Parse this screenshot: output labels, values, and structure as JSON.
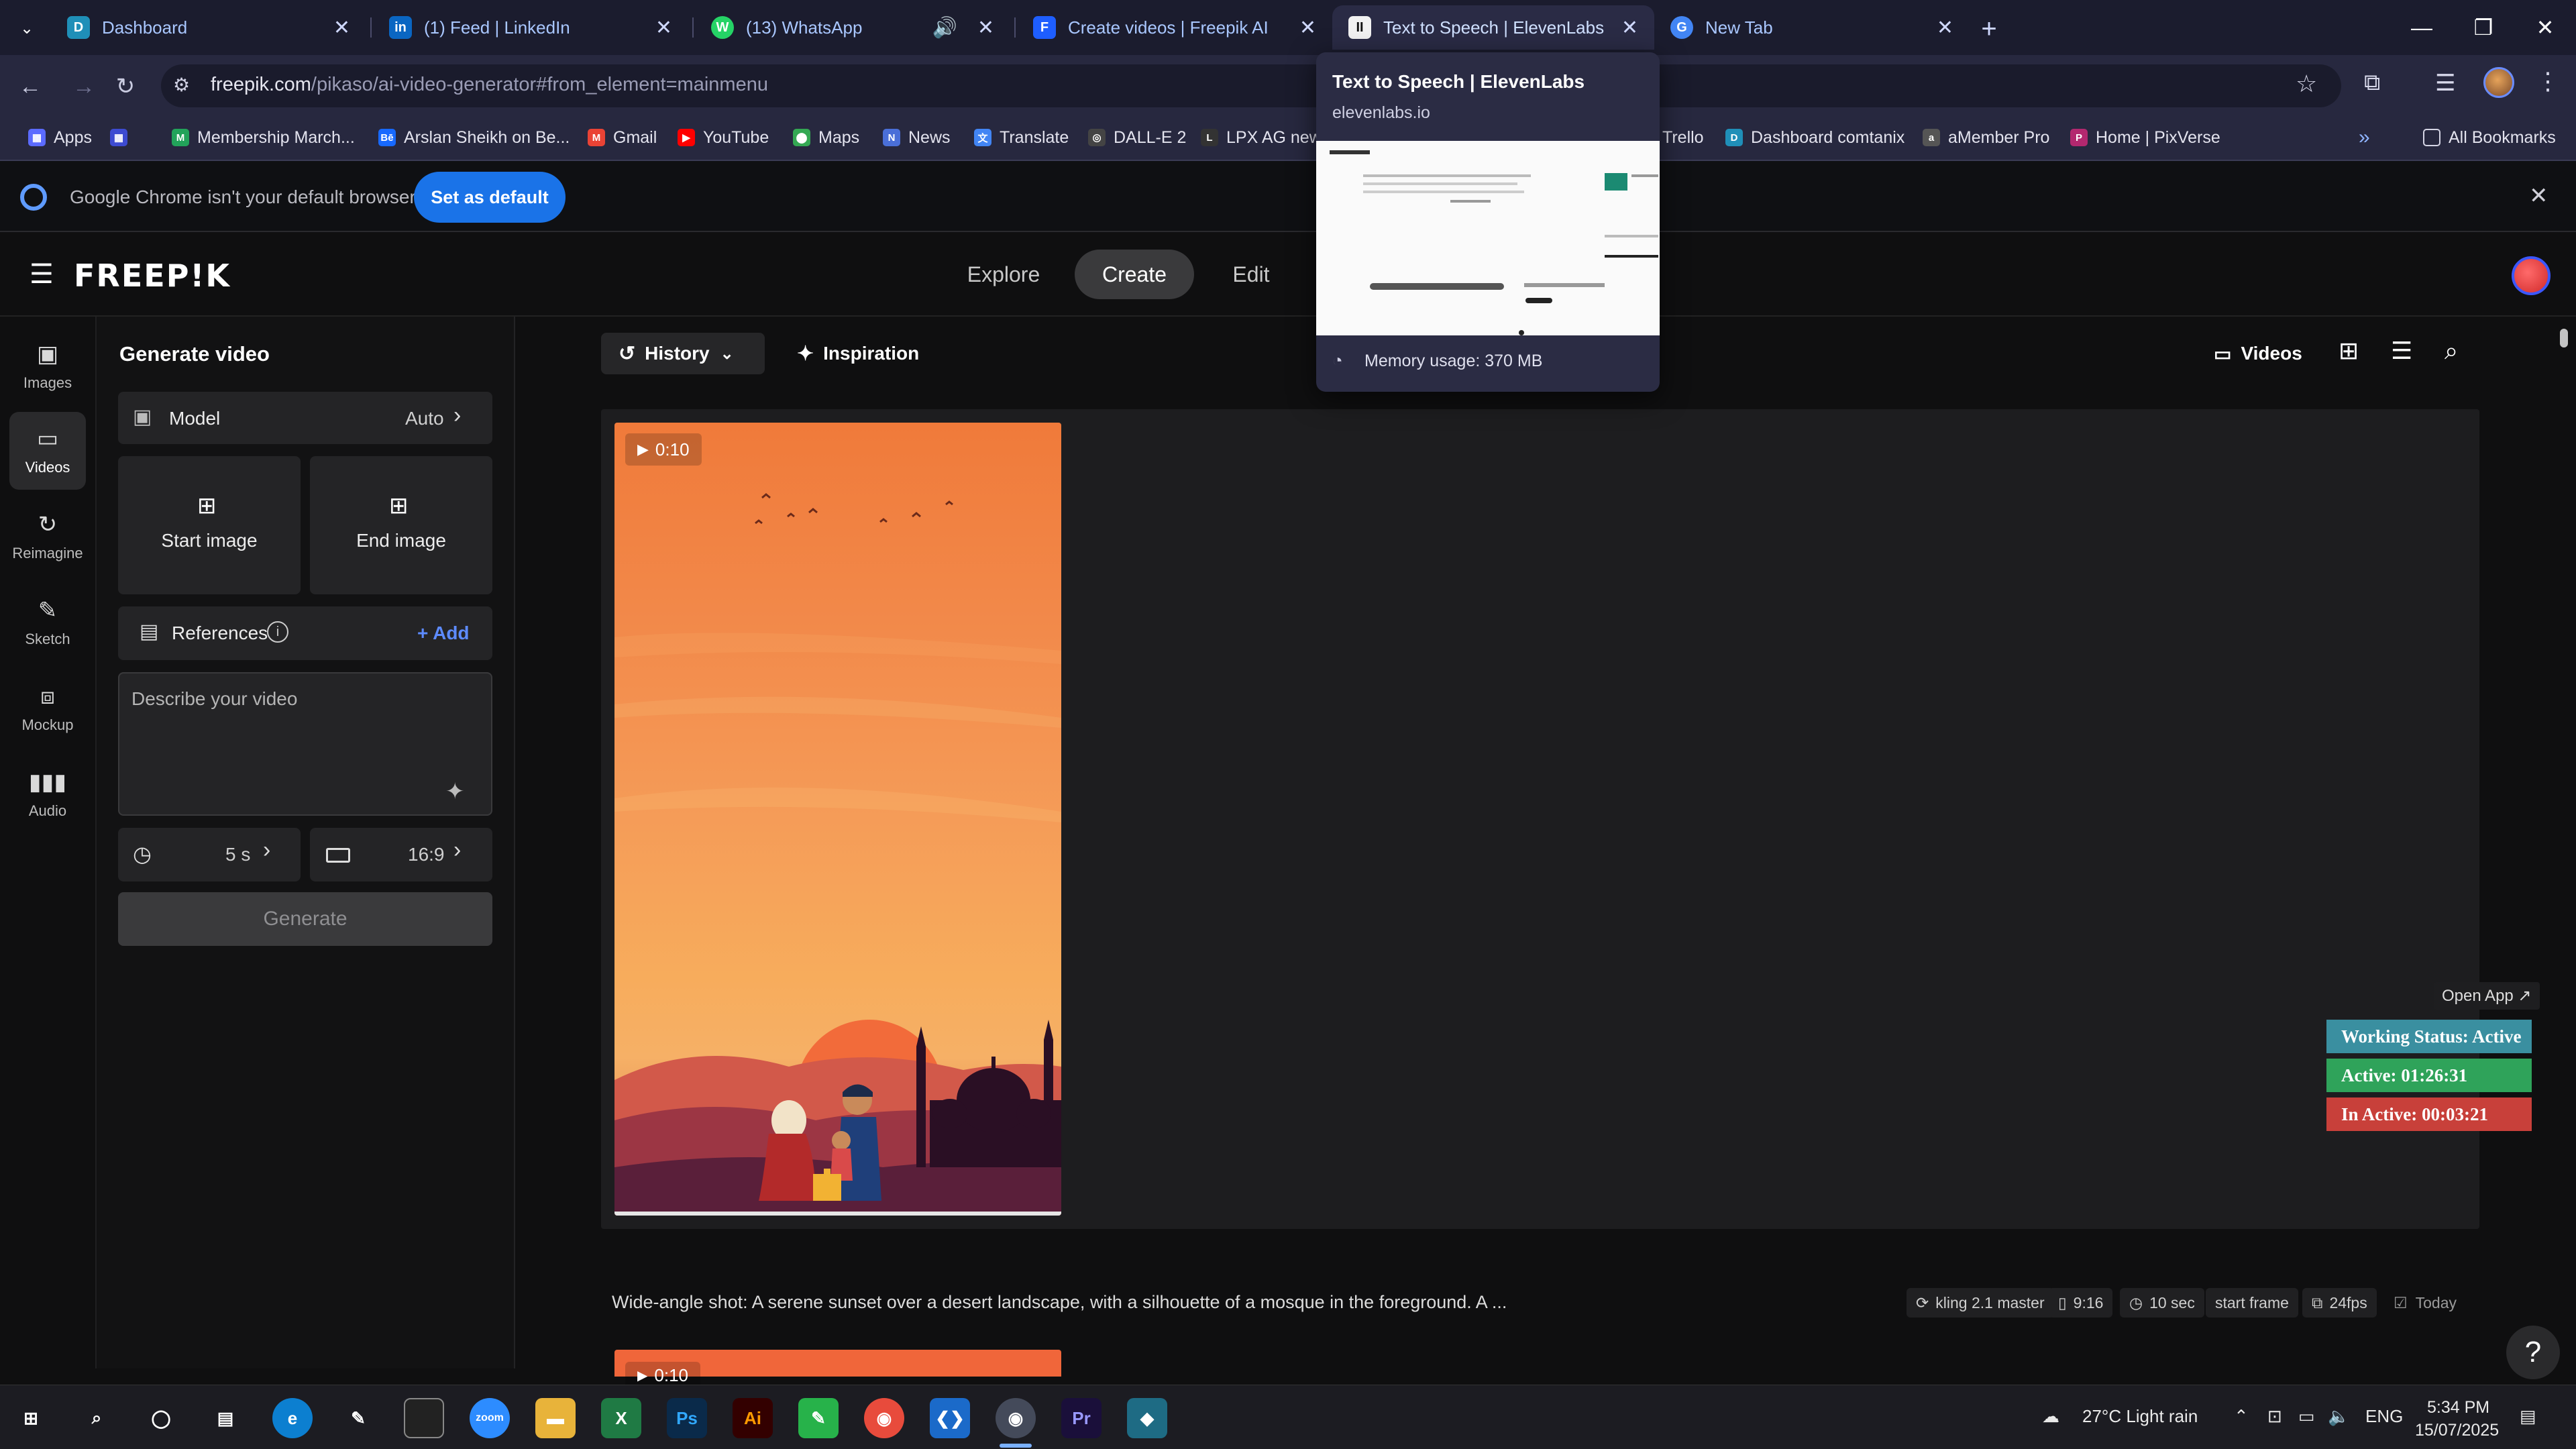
{
  "browser": {
    "tabs": [
      {
        "title": "Dashboard",
        "favicon": "D",
        "color": "#1f8fb8"
      },
      {
        "title": "(1) Feed | LinkedIn",
        "favicon": "in",
        "color": "#0a66c2"
      },
      {
        "title": "(13) WhatsApp",
        "favicon": "W",
        "color": "#25d366"
      },
      {
        "title": "Create videos | Freepik AI",
        "favicon": "F",
        "color": "#1e5eff"
      },
      {
        "title": "Text to Speech | ElevenLabs",
        "favicon": "II",
        "color": "#222222"
      },
      {
        "title": "New Tab",
        "favicon": "G",
        "color": "#4285f4"
      }
    ],
    "url_host": "freepik.com",
    "url_path": "/pikaso/ai-video-generator#from_element=mainmenu",
    "bookmarks": [
      {
        "label": "Apps"
      },
      {
        "label": "Membership March..."
      },
      {
        "label": "Arslan Sheikh on Be..."
      },
      {
        "label": "Gmail"
      },
      {
        "label": "YouTube"
      },
      {
        "label": "Maps"
      },
      {
        "label": "News"
      },
      {
        "label": "Translate"
      },
      {
        "label": "DALL-E 2"
      },
      {
        "label": "LPX AG new"
      },
      {
        "label": "Trello"
      },
      {
        "label": "Dashboard comtanix"
      },
      {
        "label": "aMember Pro"
      },
      {
        "label": "Home | PixVerse"
      },
      {
        "label": "All Bookmarks"
      }
    ],
    "default_bar": {
      "message": "Google Chrome isn't your default browser",
      "button": "Set as default"
    },
    "hover_card": {
      "title": "Text to Speech | ElevenLabs",
      "domain": "elevenlabs.io",
      "memory": "Memory usage: 370 MB"
    }
  },
  "freepik": {
    "logo": "FREEP!K",
    "nav": [
      "Explore",
      "Create",
      "Edit"
    ],
    "rail": [
      {
        "label": "Images",
        "icon": "image-icon"
      },
      {
        "label": "Videos",
        "icon": "video-icon"
      },
      {
        "label": "Reimagine",
        "icon": "refresh-icon"
      },
      {
        "label": "Sketch",
        "icon": "brush-icon"
      },
      {
        "label": "Mockup",
        "icon": "mockup-icon"
      },
      {
        "label": "Audio",
        "icon": "audio-icon"
      }
    ],
    "panel": {
      "title": "Generate video",
      "model_label": "Model",
      "model_value": "Auto",
      "start_image": "Start image",
      "end_image": "End image",
      "references": "References",
      "add": "+ Add",
      "prompt_placeholder": "Describe your video",
      "duration": "5 s",
      "aspect": "16:9",
      "generate": "Generate"
    },
    "toolbar": {
      "history": "History",
      "inspiration": "Inspiration",
      "videos": "Videos"
    },
    "item": {
      "duration": "0:10",
      "caption": "Wide-angle shot: A serene sunset over a desert landscape, with a silhouette of a mosque in the foreground. A ...",
      "meta": [
        "kling 2.1 master",
        "9:16",
        "10 sec",
        "start frame",
        "24fps",
        "Today"
      ]
    },
    "item2_duration": "0:10"
  },
  "status_widget": {
    "open_app": "Open App ↗",
    "working": "Working Status: Active",
    "active": "Active: 01:26:31",
    "inactive": "In Active: 00:03:21"
  },
  "taskbar": {
    "weather": "27°C  Light rain",
    "lang": "ENG",
    "time": "5:34 PM",
    "date": "15/07/2025"
  },
  "colors": {
    "accent": "#1a73e8",
    "working": "#3a8fa0",
    "active": "#2fa35a",
    "inactive": "#c8403a"
  }
}
